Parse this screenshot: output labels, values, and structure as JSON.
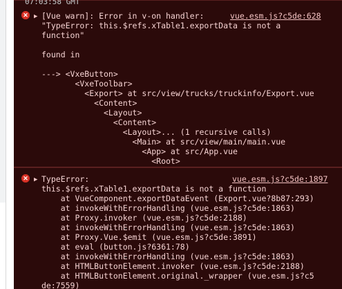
{
  "header": {
    "time_partial": "07:03:58 GMT"
  },
  "message1": {
    "arrow": "▶",
    "main": "[Vue warn]: Error in v-on handler: ",
    "source_link": "vue.esm.js?c5de:628",
    "lines": [
      "\"TypeError: this.$refs.xTable1.exportData is not a",
      "function\"",
      "",
      "found in",
      "",
      "---> <VxeButton>",
      "       <VxeToolbar>",
      "         <Export> at src/view/trucks/truckinfo/Export.vue",
      "           <Content>",
      "             <Layout>",
      "               <Content>",
      "                 <Layout>... (1 recursive calls)",
      "                   <Main> at src/view/main/main.vue",
      "                     <App> at src/App.vue",
      "                       <Root>"
    ]
  },
  "message2": {
    "arrow": "▶",
    "main": "TypeError:",
    "source_link": "vue.esm.js?c5de:1897",
    "lines": [
      "this.$refs.xTable1.exportData is not a function",
      "    at VueComponent.exportDataEvent (Export.vue?8b87:293)",
      "    at invokeWithErrorHandling (vue.esm.js?c5de:1863)",
      "    at Proxy.invoker (vue.esm.js?c5de:2188)",
      "    at invokeWithErrorHandling (vue.esm.js?c5de:1863)",
      "    at Proxy.Vue.$emit (vue.esm.js?c5de:3891)",
      "    at eval (button.js?6361:78)",
      "    at invokeWithErrorHandling (vue.esm.js?c5de:1863)",
      "    at HTMLButtonElement.invoker (vue.esm.js?c5de:2188)",
      "    at HTMLButtonElement.original._wrapper (vue.esm.js?c5",
      "de:7559)"
    ]
  },
  "icons": {
    "error": "✕",
    "expand": "▶"
  },
  "colors": {
    "console_bg": "#2b0a0a",
    "error_text": "#f6d3d3",
    "error_icon": "#d93025",
    "header_text": "#c9cbcd"
  }
}
